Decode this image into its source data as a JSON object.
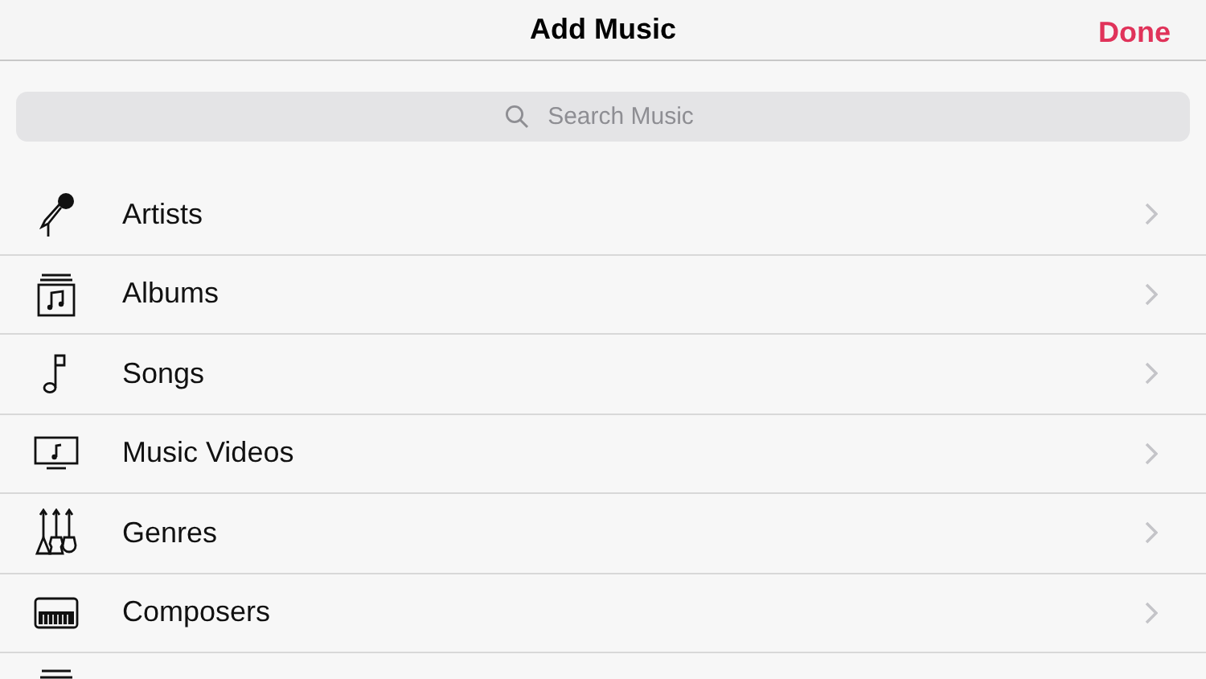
{
  "nav": {
    "title": "Add Music",
    "done": "Done"
  },
  "search": {
    "placeholder": "Search Music"
  },
  "items": [
    {
      "kind": "microphone",
      "label": "Artists"
    },
    {
      "kind": "album",
      "label": "Albums"
    },
    {
      "kind": "note",
      "label": "Songs"
    },
    {
      "kind": "video",
      "label": "Music Videos"
    },
    {
      "kind": "guitars",
      "label": "Genres"
    },
    {
      "kind": "piano",
      "label": "Composers"
    },
    {
      "kind": "stack"
    }
  ]
}
